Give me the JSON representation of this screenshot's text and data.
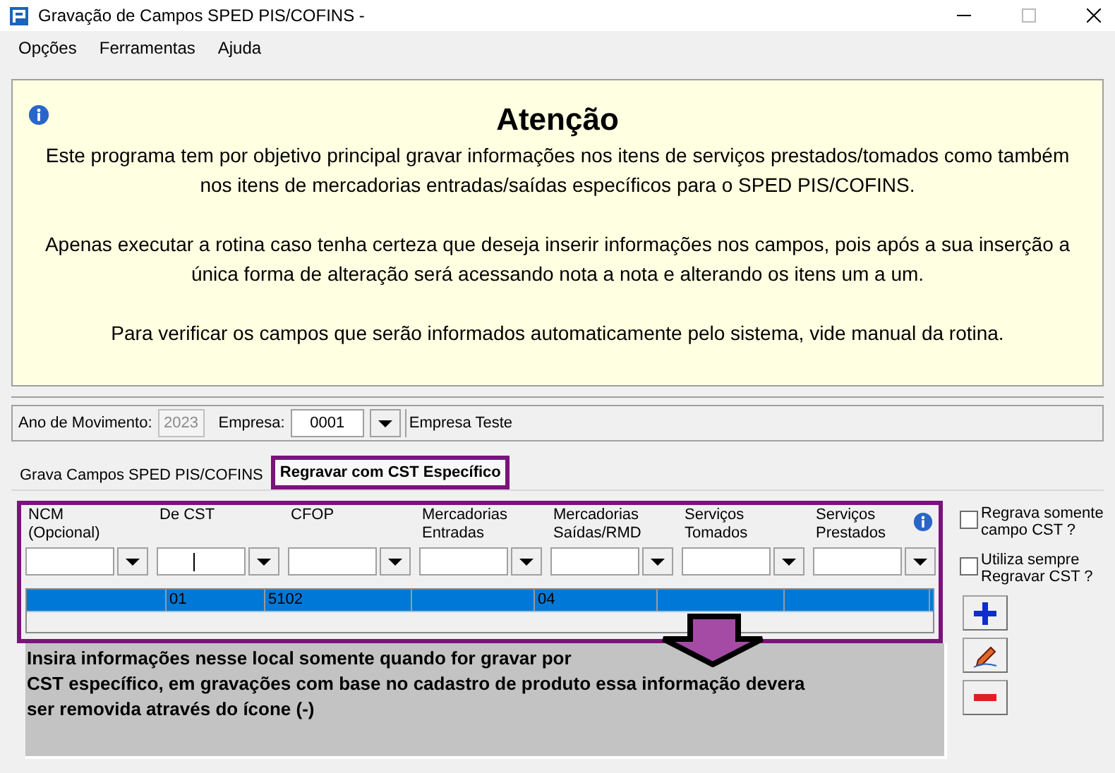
{
  "window": {
    "title": "Gravação de Campos SPED PIS/COFINS -"
  },
  "menu": [
    "Opções",
    "Ferramentas",
    "Ajuda"
  ],
  "notice": {
    "title": "Atenção",
    "paragraphs": [
      "Este programa tem por objetivo principal gravar informações nos itens de serviços prestados/tomados como também nos itens de mercadorias entradas/saídas específicos para o SPED PIS/COFINS.",
      "Apenas executar a rotina caso tenha certeza que deseja inserir informações nos campos, pois após a sua inserção a única forma de alteração será acessando nota a nota e alterando os itens um a um.",
      "Para verificar os campos que serão informados automaticamente pelo sistema, vide manual da rotina."
    ]
  },
  "filters": {
    "year_label": "Ano de Movimento:",
    "year": "2023",
    "company_label": "Empresa:",
    "company_code": "0001",
    "company_name": "Empresa Teste"
  },
  "tabs": [
    {
      "label": "Grava Campos SPED PIS/COFINS",
      "selected": false
    },
    {
      "label": "Regravar com CST Específico",
      "selected": true
    }
  ],
  "fields": [
    {
      "label": "NCM\n(Opcional)"
    },
    {
      "label": "De CST"
    },
    {
      "label": "CFOP"
    },
    {
      "label": "Mercadorias\nEntradas"
    },
    {
      "label": "Mercadorias\nSaídas/RMD"
    },
    {
      "label": "Serviços\nTomados"
    },
    {
      "label": "Serviços\nPrestados"
    }
  ],
  "rows": [
    {
      "cells": [
        "",
        "01",
        "5102",
        "",
        "04",
        "",
        ""
      ],
      "selected": true
    }
  ],
  "options": [
    {
      "label": "Regrava somente\ncampo CST ?",
      "checked": false
    },
    {
      "label": "Utiliza sempre\nRegravar CST ?",
      "checked": false
    }
  ],
  "hint": "Insira informações nesse local somente quando for gravar por\nCST específico, em gravações com base no cadastro de produto essa informação devera\nser removida através do ícone (-)"
}
